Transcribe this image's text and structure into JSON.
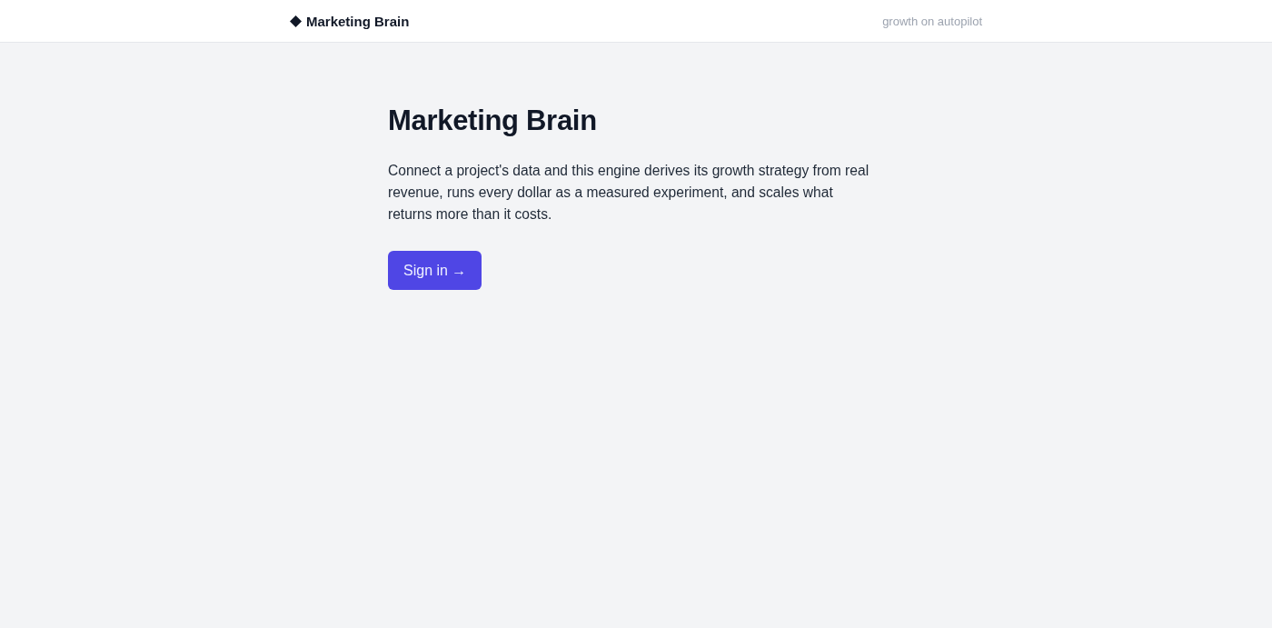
{
  "header": {
    "brand": "Marketing Brain",
    "tagline": "growth on autopilot"
  },
  "hero": {
    "title": "Marketing Brain",
    "description": "Connect a project's data and this engine derives its growth strategy from real revenue, runs every dollar as a measured experiment, and scales what returns more than it costs.",
    "button": "Sign in →"
  }
}
